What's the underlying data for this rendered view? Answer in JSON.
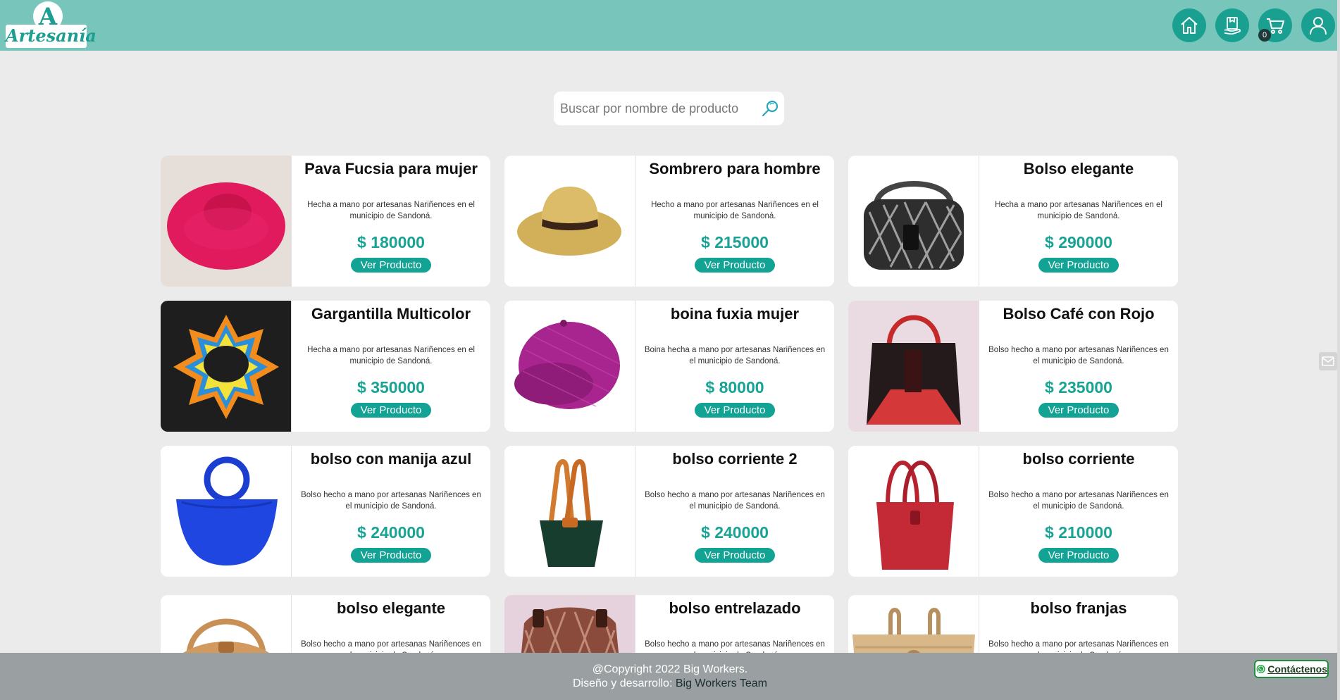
{
  "brand": {
    "logo_text": "Artesanía"
  },
  "header": {
    "cart_count": "0",
    "icons": [
      "home-icon",
      "package-icon",
      "cart-icon",
      "user-icon"
    ]
  },
  "search": {
    "placeholder": "Buscar por nombre de producto",
    "value": ""
  },
  "products": [
    {
      "name": "Pava Fucsia para mujer",
      "description": "Hecha a mano por artesanas Nariñences en el municipio de Sandoná.",
      "price": "$ 180000",
      "button": "Ver Producto",
      "image": "fuchsia-hat"
    },
    {
      "name": "Sombrero para hombre",
      "description": "Hecho a mano por artesanas Nariñences en el municipio de Sandoná.",
      "price": "$ 215000",
      "button": "Ver Producto",
      "image": "straw-hat"
    },
    {
      "name": "Bolso elegante",
      "description": "Hecha a mano por artesanas Nariñences en el municipio de Sandoná.",
      "price": "$ 290000",
      "button": "Ver Producto",
      "image": "black-white-bag"
    },
    {
      "name": "Gargantilla Multicolor",
      "description": "Hecha a mano por artesanas Nariñences en el municipio de Sandoná.",
      "price": "$ 350000",
      "button": "Ver Producto",
      "image": "multicolor-necklace"
    },
    {
      "name": "boina fuxia mujer",
      "description": "Boina hecha a mano por artesanas Nariñences en el municipio de Sandoná.",
      "price": "$ 80000",
      "button": "Ver Producto",
      "image": "fuchsia-beret"
    },
    {
      "name": "Bolso Café con Rojo",
      "description": "Bolso hecho a mano por artesanas Nariñences en el municipio de Sandoná.",
      "price": "$ 235000",
      "button": "Ver Producto",
      "image": "brown-red-bag"
    },
    {
      "name": "bolso con manija azul",
      "description": "Bolso hecho a mano por artesanas Nariñences en el municipio de Sandoná.",
      "price": "$ 240000",
      "button": "Ver Producto",
      "image": "blue-bag"
    },
    {
      "name": "bolso corriente 2",
      "description": "Bolso hecho a mano por artesanas Nariñences en el municipio de Sandoná.",
      "price": "$ 240000",
      "button": "Ver Producto",
      "image": "green-tote"
    },
    {
      "name": "bolso corriente",
      "description": "Bolso hecho a mano por artesanas Nariñences en el municipio de Sandoná.",
      "price": "$ 210000",
      "button": "Ver Producto",
      "image": "red-tote"
    },
    {
      "name": "bolso elegante",
      "description": "Bolso hecho a mano por artesanas Nariñences en el municipio de Sandoná.",
      "price": "",
      "button": "",
      "image": "tan-bag"
    },
    {
      "name": "bolso entrelazado",
      "description": "Bolso hecho a mano por artesanas Nariñences en el municipio de Sandoná.",
      "price": "",
      "button": "",
      "image": "woven-bag"
    },
    {
      "name": "bolso franjas",
      "description": "Bolso hecho a mano por artesanas Nariñences en el municipio de Sandoná.",
      "price": "",
      "button": "",
      "image": "striped-bag"
    }
  ],
  "footer": {
    "copyright": "@Copyright 2022 Big Workers.",
    "credit_label": "Diseño y desarrollo:",
    "credit_team": "Big Workers Team"
  },
  "contact": {
    "label": "Contáctenos",
    "icon": "whatsapp-icon"
  },
  "colors": {
    "header": "#78c5bc",
    "accent": "#1aa091",
    "price": "#18a394",
    "footer": "#9aa0a1",
    "background": "#ebebeb"
  }
}
